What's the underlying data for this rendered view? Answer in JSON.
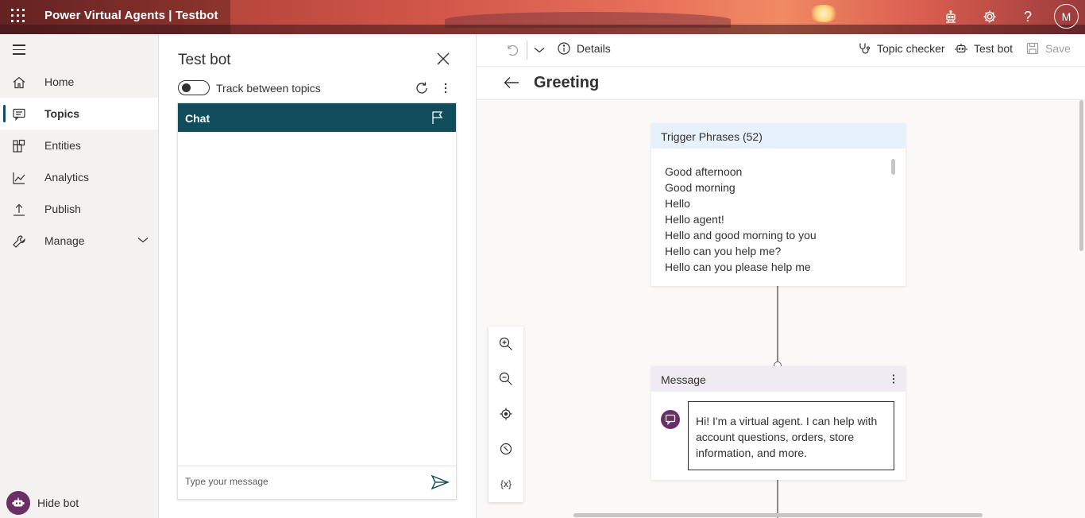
{
  "header": {
    "title": "Power Virtual Agents | Testbot",
    "avatar_initial": "M",
    "icons": [
      "waffle-icon",
      "bot-icon",
      "settings-icon",
      "help-icon"
    ]
  },
  "nav": {
    "items": [
      {
        "label": "Home",
        "icon": "home-icon"
      },
      {
        "label": "Topics",
        "icon": "chat-icon",
        "active": true
      },
      {
        "label": "Entities",
        "icon": "entities-icon"
      },
      {
        "label": "Analytics",
        "icon": "analytics-icon"
      },
      {
        "label": "Publish",
        "icon": "publish-icon"
      },
      {
        "label": "Manage",
        "icon": "wrench-icon",
        "expandable": true
      }
    ],
    "hide_bot_label": "Hide bot"
  },
  "testbot": {
    "title": "Test bot",
    "track_label": "Track between topics",
    "track_enabled": false,
    "chat_header": "Chat",
    "input_placeholder": "Type your message"
  },
  "toolbar": {
    "details_label": "Details",
    "topic_checker_label": "Topic checker",
    "test_bot_label": "Test bot",
    "save_label": "Save"
  },
  "topic": {
    "title": "Greeting"
  },
  "trigger_node": {
    "header": "Trigger Phrases (52)",
    "phrases": [
      "Good afternoon",
      "Good morning",
      "Hello",
      "Hello agent!",
      "Hello and good morning to you",
      "Hello can you help me?",
      "Hello can you please help me"
    ]
  },
  "message_node": {
    "header": "Message",
    "text": "Hi! I'm a virtual agent. I can help with account questions, orders, store information, and more."
  },
  "zoom_controls": {
    "variable_label": "{x}"
  },
  "colors": {
    "accent": "#0f4c5c",
    "bot_purple": "#6b2f67",
    "trigger_header": "#e7f1fb",
    "message_header": "#f0ebf2"
  }
}
